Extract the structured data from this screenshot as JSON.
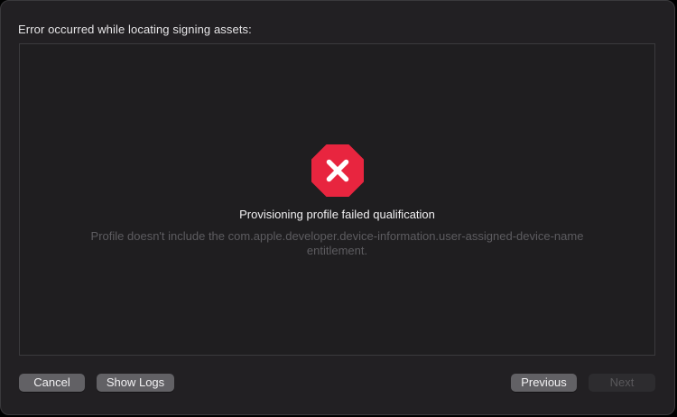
{
  "dialog": {
    "header": "Error occurred while locating signing assets:",
    "error": {
      "icon": "error-octagon-icon",
      "icon_color": "#e8253f",
      "title": "Provisioning profile failed qualification",
      "message_line1": "Profile doesn't include the com.apple.developer.device-information.user-assigned-device-name",
      "message_line2": "entitlement."
    },
    "buttons": {
      "cancel": "Cancel",
      "show_logs": "Show Logs",
      "previous": "Previous",
      "next": "Next"
    }
  }
}
